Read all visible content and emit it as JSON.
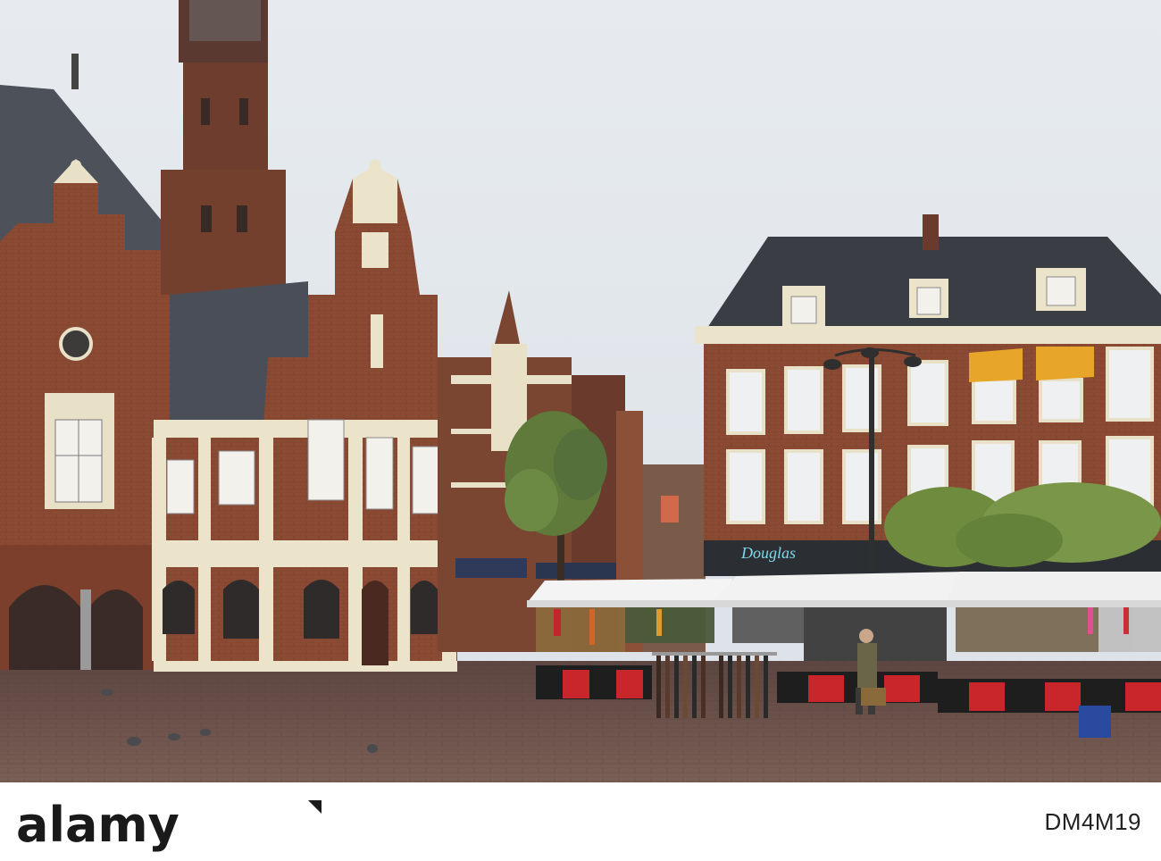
{
  "scene": {
    "description_colors": {
      "sky": "#dfe4ea",
      "brick": "#8a4a33",
      "cream": "#efe6cf",
      "roof": "#4d525b",
      "cobbles": "#6e544c",
      "awning": "#e7a52a",
      "market_red": "#c9262b",
      "tree": "#5f7a3a"
    },
    "shop_sign": "Douglas",
    "shop_sign_color": "#7fd8e8"
  },
  "footer": {
    "brand": "alamy",
    "image_code": "DM4M19"
  }
}
